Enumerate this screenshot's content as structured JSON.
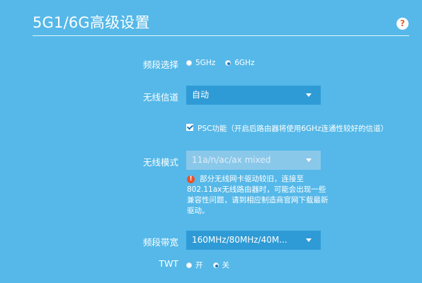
{
  "page": {
    "title": "5G1/6G高级设置",
    "help_icon": "help-icon",
    "help_glyph": "?"
  },
  "band_select": {
    "label": "频段选择",
    "options": [
      "5GHz",
      "6GHz"
    ],
    "selected": "6GHz"
  },
  "wireless_channel": {
    "label": "无线信道",
    "value": "自动"
  },
  "psc": {
    "checked": true,
    "text": "PSC功能（开启后路由器将使用6GHz连通性较好的信道）"
  },
  "wireless_mode": {
    "label": "无线模式",
    "value": "11a/n/ac/ax mixed",
    "disabled": true,
    "warning_glyph": "!",
    "warning": "部分无线网卡驱动较旧，连接至802.11ax无线路由器时，可能会出现一些兼容性问题，请到相应制造商官网下载最新驱动。"
  },
  "bandwidth": {
    "label": "频段带宽",
    "value": "160MHz/80MHz/40M..."
  },
  "twt": {
    "label": "TWT",
    "options": [
      "开",
      "关"
    ],
    "selected": "关"
  },
  "colors": {
    "background": "#55b8e8",
    "select_bg": "#2f9bd6",
    "warning": "#e8532a"
  }
}
